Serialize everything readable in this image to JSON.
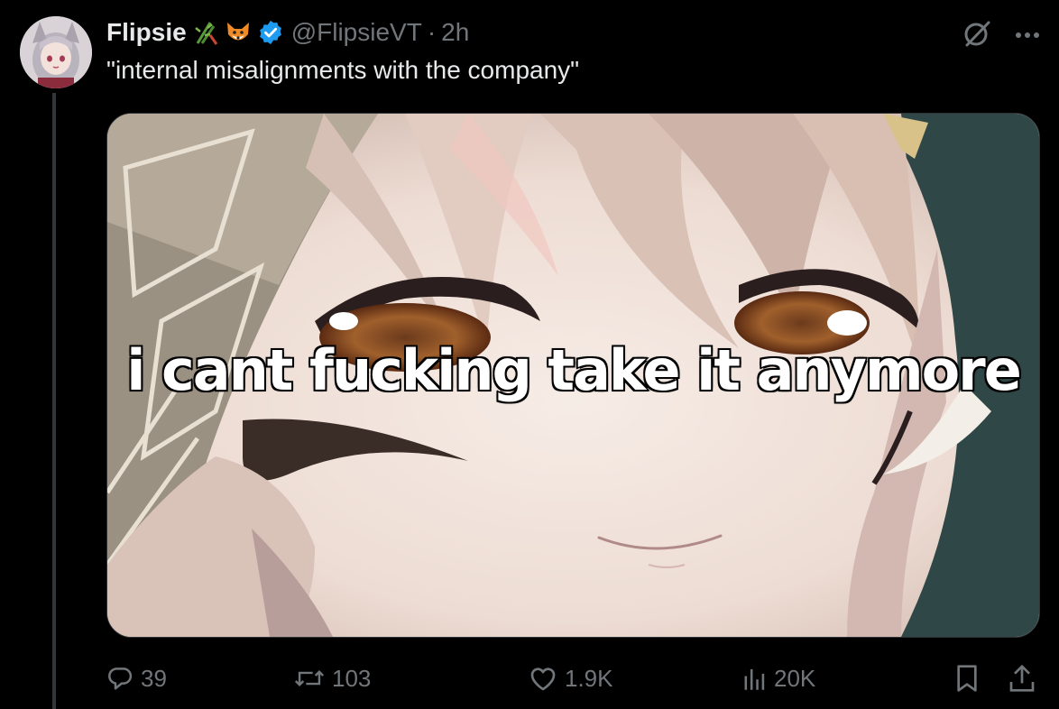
{
  "author": {
    "display_name": "Flipsie",
    "handle": "@FlipsieVT",
    "separator": "·",
    "time": "2h",
    "emojis": [
      "bamboo-icon",
      "fox-icon"
    ],
    "verified": true
  },
  "tweet": {
    "text": "\"internal misalignments with the company\""
  },
  "media": {
    "caption": "i cant fucking take it anymore"
  },
  "actions": {
    "replies": "39",
    "reposts": "103",
    "likes": "1.9K",
    "views": "20K"
  },
  "colors": {
    "background": "#000000",
    "text": "#e7e9ea",
    "muted": "#71767b",
    "verified": "#1d9bf0",
    "border": "#2f3336"
  }
}
